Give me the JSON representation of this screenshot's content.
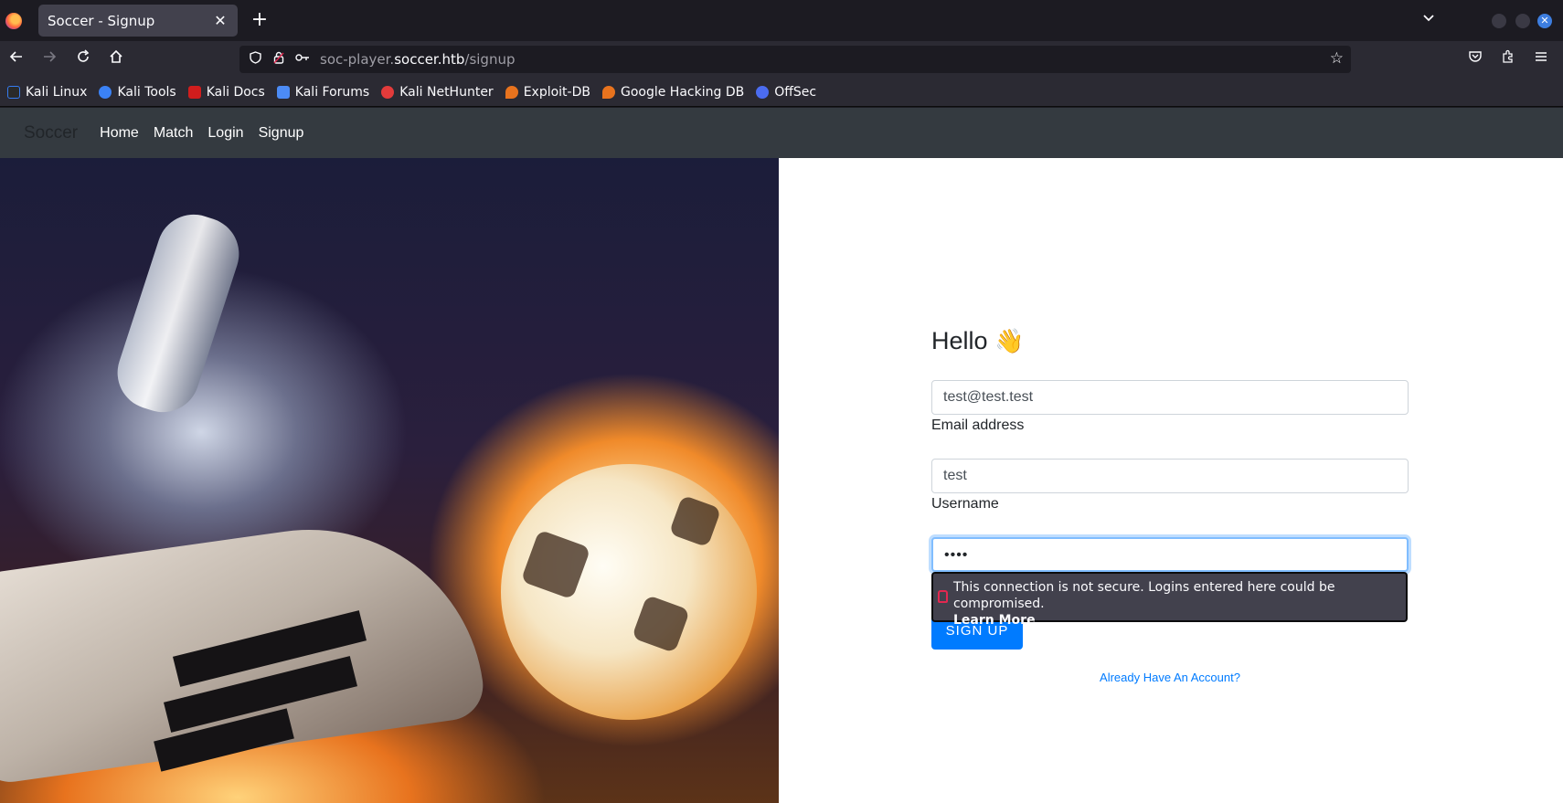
{
  "browser": {
    "tab_title": "Soccer - Signup",
    "tab_close": "✕",
    "new_tab": "+",
    "url_prefix": "soc-player.",
    "url_domain": "soccer.htb",
    "url_path": "/signup",
    "bookmarks": [
      {
        "label": "Kali Linux",
        "color": "#367bf0"
      },
      {
        "label": "Kali Tools",
        "color": "#3b82f6"
      },
      {
        "label": "Kali Docs",
        "color": "#d11d1d"
      },
      {
        "label": "Kali Forums",
        "color": "#4c8bf5"
      },
      {
        "label": "Kali NetHunter",
        "color": "#e33b3b"
      },
      {
        "label": "Exploit-DB",
        "color": "#e8731e"
      },
      {
        "label": "Google Hacking DB",
        "color": "#e8731e"
      },
      {
        "label": "OffSec",
        "color": "#4b6cf0"
      }
    ]
  },
  "site": {
    "brand": "Soccer",
    "nav": [
      "Home",
      "Match",
      "Login",
      "Signup"
    ]
  },
  "form": {
    "greeting": "Hello",
    "wave": "👋",
    "email_value": "test@test.test",
    "email_label": "Email address",
    "username_value": "test",
    "username_label": "Username",
    "password_value": "••••",
    "warning_text": "This connection is not secure. Logins entered here could be compromised.",
    "warning_link": "Learn More",
    "signup_button": "SIGN UP",
    "login_link": "Already Have An Account?"
  },
  "colors": {
    "accent": "#007bff",
    "navbar": "#343a40"
  }
}
